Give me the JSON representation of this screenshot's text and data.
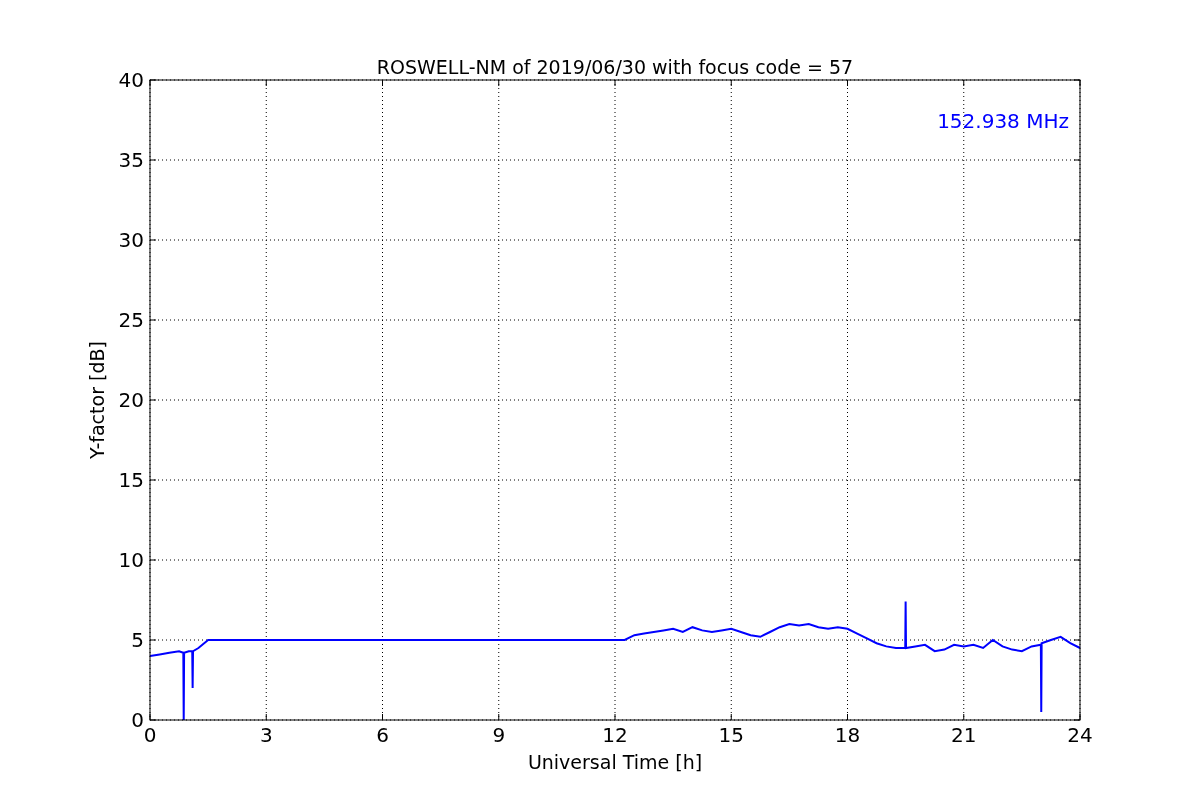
{
  "chart_data": {
    "type": "line",
    "title": "ROSWELL-NM of 2019/06/30 with focus code = 57",
    "xlabel": "Universal Time [h]",
    "ylabel": "Y-factor [dB]",
    "x": [
      0,
      0.25,
      0.5,
      0.75,
      0.86,
      0.87,
      0.88,
      1.0,
      1.09,
      1.1,
      1.11,
      1.25,
      1.5,
      3,
      6,
      9,
      12.25,
      12.5,
      12.75,
      13,
      13.25,
      13.5,
      13.75,
      14,
      14.25,
      14.5,
      14.75,
      15,
      15.25,
      15.5,
      15.75,
      16,
      16.25,
      16.5,
      16.75,
      17,
      17.25,
      17.5,
      17.75,
      18,
      18.25,
      18.5,
      18.75,
      19,
      19.25,
      19.49,
      19.5,
      19.51,
      19.75,
      20,
      20.25,
      20.5,
      20.75,
      21,
      21.25,
      21.5,
      21.75,
      22,
      22.25,
      22.5,
      22.75,
      22.99,
      23.0,
      23.01,
      23.25,
      23.5,
      23.75,
      24
    ],
    "series": [
      {
        "name": "152.938 MHz",
        "color": "#0000ff",
        "values": [
          4.0,
          4.1,
          4.2,
          4.3,
          4.2,
          0,
          4.2,
          4.3,
          4.3,
          2,
          4.3,
          4.5,
          5.0,
          5.0,
          5.0,
          5.0,
          5.0,
          5.3,
          5.4,
          5.5,
          5.6,
          5.7,
          5.5,
          5.8,
          5.6,
          5.5,
          5.6,
          5.7,
          5.5,
          5.3,
          5.2,
          5.5,
          5.8,
          6.0,
          5.9,
          6.0,
          5.8,
          5.7,
          5.8,
          5.7,
          5.4,
          5.1,
          4.8,
          4.6,
          4.5,
          4.5,
          7.4,
          4.5,
          4.6,
          4.7,
          4.3,
          4.4,
          4.7,
          4.6,
          4.7,
          4.5,
          5.0,
          4.6,
          4.4,
          4.3,
          4.6,
          4.7,
          0.5,
          4.8,
          5.0,
          5.2,
          4.8,
          4.5
        ]
      }
    ],
    "xlim": [
      0,
      24
    ],
    "ylim": [
      0,
      40
    ],
    "xticks": [
      0,
      3,
      6,
      9,
      12,
      15,
      18,
      21,
      24
    ],
    "yticks": [
      0,
      5,
      10,
      15,
      20,
      25,
      30,
      35,
      40
    ],
    "grid": true
  }
}
